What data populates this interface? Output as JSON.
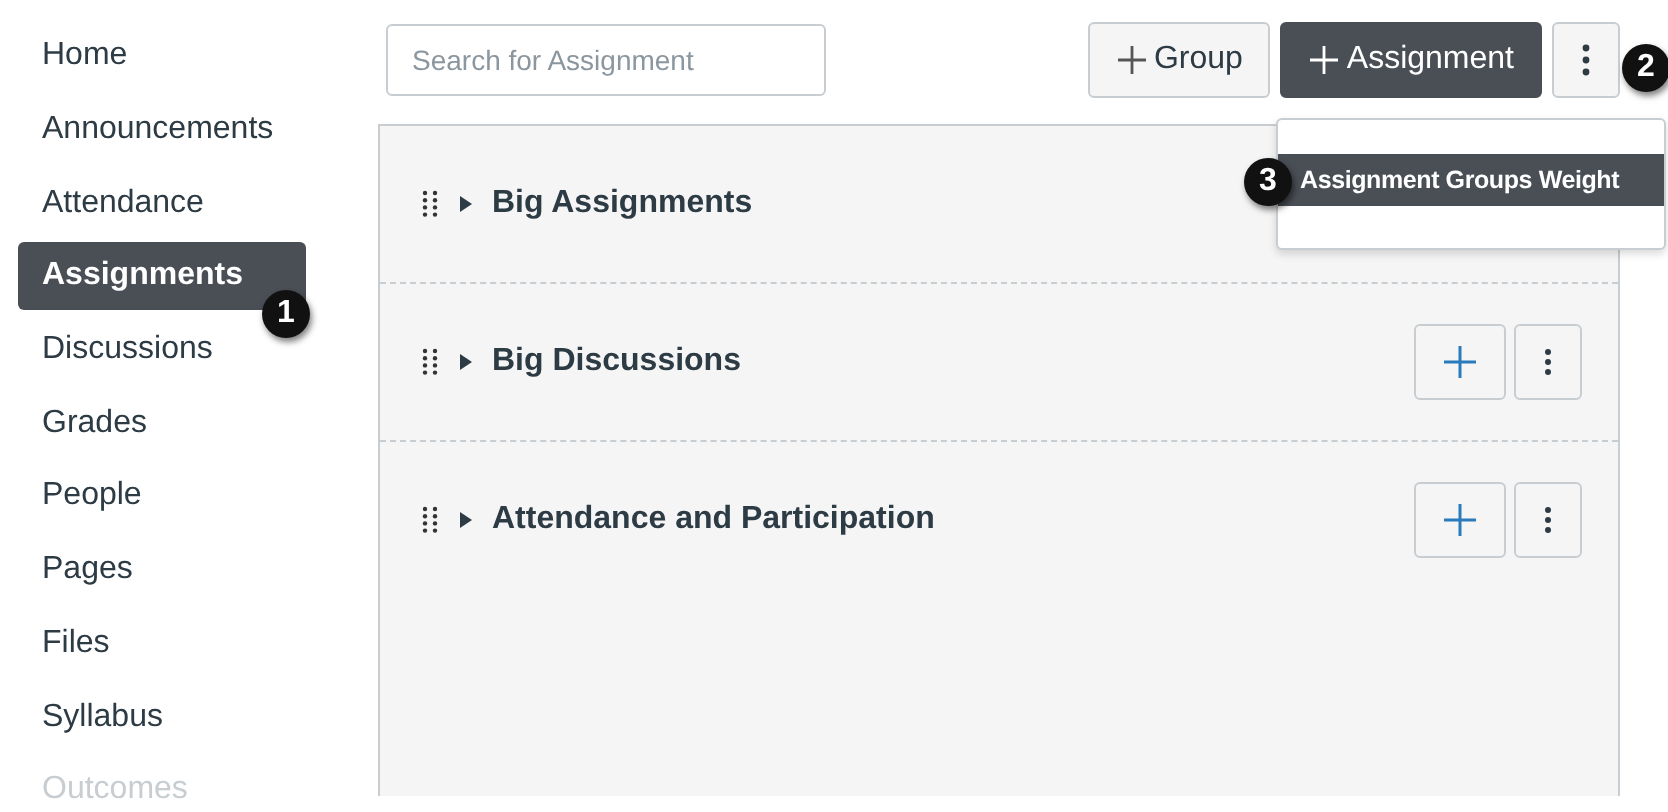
{
  "nav": [
    {
      "label": "Home",
      "selected": false,
      "disabled": false
    },
    {
      "label": "Announcements",
      "selected": false,
      "disabled": false
    },
    {
      "label": "Attendance",
      "selected": false,
      "disabled": false
    },
    {
      "label": "Assignments",
      "selected": true,
      "disabled": false,
      "callout": "1"
    },
    {
      "label": "Discussions",
      "selected": false,
      "disabled": false
    },
    {
      "label": "Grades",
      "selected": false,
      "disabled": false
    },
    {
      "label": "People",
      "selected": false,
      "disabled": false
    },
    {
      "label": "Pages",
      "selected": false,
      "disabled": false
    },
    {
      "label": "Files",
      "selected": false,
      "disabled": false
    },
    {
      "label": "Syllabus",
      "selected": false,
      "disabled": false
    },
    {
      "label": "Outcomes",
      "selected": false,
      "disabled": true
    }
  ],
  "search": {
    "placeholder": "Search for Assignment"
  },
  "toolbar": {
    "group_button": "Group",
    "assignment_button": "Assignment",
    "more_callout": "2"
  },
  "menu": {
    "items": [
      {
        "label": "Assignment Groups Weight",
        "selected": true,
        "callout": "3"
      }
    ]
  },
  "groups": [
    {
      "title": "Big Assignments"
    },
    {
      "title": "Big Discussions",
      "actions": true
    },
    {
      "title": "Attendance and Participation",
      "actions": true
    }
  ]
}
